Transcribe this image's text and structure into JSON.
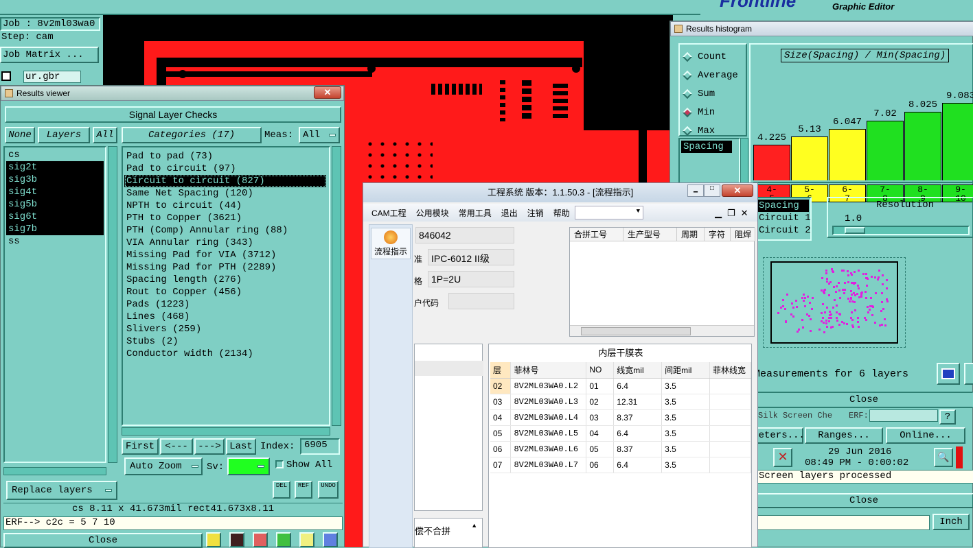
{
  "top": {
    "job": "Job : 8v2ml03wa0",
    "step": "Step: cam",
    "job_matrix": "Job Matrix ...",
    "layer_file": "ur.gbr",
    "frontline_logo": "Frontline",
    "graphic_editor": "Graphic Editor"
  },
  "results_viewer": {
    "title": "Results viewer",
    "header": "Signal Layer Checks",
    "none_btn": "None",
    "layers_btn": "Layers",
    "all_btn": "All",
    "categories_btn": "Categories (17)",
    "meas_label": "Meas:",
    "meas_value": "All",
    "layers": [
      {
        "name": "cs",
        "selected": false
      },
      {
        "name": "sig2t",
        "selected": true
      },
      {
        "name": "sig3b",
        "selected": true
      },
      {
        "name": "sig4t",
        "selected": true
      },
      {
        "name": "sig5b",
        "selected": true
      },
      {
        "name": "sig6t",
        "selected": true
      },
      {
        "name": "sig7b",
        "selected": true
      },
      {
        "name": "ss",
        "selected": false
      }
    ],
    "categories": [
      {
        "label": "Pad to pad (73)",
        "selected": false
      },
      {
        "label": "Pad to circuit (97)",
        "selected": false
      },
      {
        "label": "Circuit to circuit (827)",
        "selected": true
      },
      {
        "label": "Same Net Spacing (120)",
        "selected": false
      },
      {
        "label": "NPTH to circuit (44)",
        "selected": false
      },
      {
        "label": "PTH to Copper (3621)",
        "selected": false
      },
      {
        "label": "PTH (Comp) Annular ring (88)",
        "selected": false
      },
      {
        "label": "VIA Annular ring (343)",
        "selected": false
      },
      {
        "label": "Missing Pad for VIA (3712)",
        "selected": false
      },
      {
        "label": "Missing Pad for PTH (2289)",
        "selected": false
      },
      {
        "label": "Spacing length (276)",
        "selected": false
      },
      {
        "label": "Rout to Copper (456)",
        "selected": false
      },
      {
        "label": "Pads (1223)",
        "selected": false
      },
      {
        "label": "Lines (468)",
        "selected": false
      },
      {
        "label": "Slivers (259)",
        "selected": false
      },
      {
        "label": "Stubs (2)",
        "selected": false
      },
      {
        "label": "Conductor width (2134)",
        "selected": false
      }
    ],
    "first": "First",
    "prev": "<---",
    "next": "--->",
    "last": "Last",
    "index_label": "Index:",
    "index_value": "6905",
    "auto_zoom": "Auto Zoom",
    "sv_label": "Sv:",
    "show_all": "Show All",
    "replace_layers": "Replace layers",
    "del": "DEL",
    "ref": "REF",
    "undo": "UNDO",
    "status": "cs 8.11 x 41.673mil  rect41.673x8.11",
    "erf": "ERF--> c2c = 5 7 10",
    "close": "Close"
  },
  "histogram": {
    "title": "Results histogram",
    "modes": [
      {
        "label": "Count",
        "on": false
      },
      {
        "label": "Average",
        "on": false
      },
      {
        "label": "Sum",
        "on": false
      },
      {
        "label": "Min",
        "on": true
      },
      {
        "label": "Max",
        "on": false
      }
    ],
    "chart_title": "Size(Spacing) / Min(Spacing)",
    "spacing_label": "Spacing",
    "list_items": [
      "Spacing",
      "Circuit 1",
      "Circuit 2"
    ],
    "resolution_label": "Resolution",
    "resolution_value": "1.0",
    "measurements": "Measurements for 6 layers",
    "close": "Close",
    "colors": {
      "red": "#ff2020",
      "yellow": "#ffff20",
      "green": "#20e020"
    }
  },
  "chart_data": {
    "type": "bar",
    "title": "Size(Spacing) / Min(Spacing)",
    "categories": [
      "4-5",
      "5-6",
      "6-7",
      "7-8",
      "8-9",
      "9-10"
    ],
    "tick_top": [
      "4-",
      "5-",
      "6-",
      "7-",
      "8-",
      "9-"
    ],
    "tick_bottom": [
      "5",
      "6",
      "7",
      "8",
      "9",
      "10"
    ],
    "values": [
      4.225,
      5.13,
      6.047,
      7.02,
      8.025,
      9.083
    ],
    "labels": [
      "4.225",
      "5.13",
      "6.047",
      "7.02",
      "8.025",
      "9.083"
    ],
    "colors": [
      "#ff2020",
      "#ffff20",
      "#ffff20",
      "#20e020",
      "#20e020",
      "#20e020"
    ],
    "ylim": [
      0,
      10
    ]
  },
  "lower_right": {
    "silk_screen": "Silk Screen Che",
    "erf": "ERF:",
    "parameters": "meters...",
    "ranges": "Ranges...",
    "online": "Online...",
    "date": "29 Jun 2016",
    "time": "08:49 PM - 0:00:02",
    "status": "Screen layers processed",
    "close": "Close",
    "unit": "Inch"
  },
  "cn_app": {
    "title": "工程系统  版本：1.1.50.3 - [流程指示]",
    "menu": [
      "CAM工程",
      "公用模块",
      "常用工具",
      "退出",
      "注销",
      "帮助"
    ],
    "side_btn": "流程指示",
    "field1_value": "846042",
    "field2_label": "准",
    "field2_value": "IPC-6012 II级",
    "field3_label": "格",
    "field3_value": "1P=2U",
    "field4_label": "户代码",
    "field4_value": "",
    "grid_headers": [
      "合拼工号",
      "生产型号",
      "周期",
      "字符",
      "阻焊"
    ],
    "inner_title": "内层干膜表",
    "inner_headers": [
      "层",
      "菲林号",
      "NO",
      "线宽mil",
      "间距mil",
      "菲林线宽"
    ],
    "inner_rows": [
      [
        "02",
        "8V2ML03WA0.L2",
        "01",
        "6.4",
        "3.5",
        ""
      ],
      [
        "03",
        "8V2ML03WA0.L3",
        "02",
        "12.31",
        "3.5",
        ""
      ],
      [
        "04",
        "8V2ML03WA0.L4",
        "03",
        "8.37",
        "3.5",
        ""
      ],
      [
        "05",
        "8V2ML03WA0.L5",
        "04",
        "6.4",
        "3.5",
        ""
      ],
      [
        "06",
        "8V2ML03WA0.L6",
        "05",
        "8.37",
        "3.5",
        ""
      ],
      [
        "07",
        "8V2ML03WA0.L7",
        "06",
        "6.4",
        "3.5",
        ""
      ]
    ],
    "bottom_text": "偿不合拼"
  }
}
